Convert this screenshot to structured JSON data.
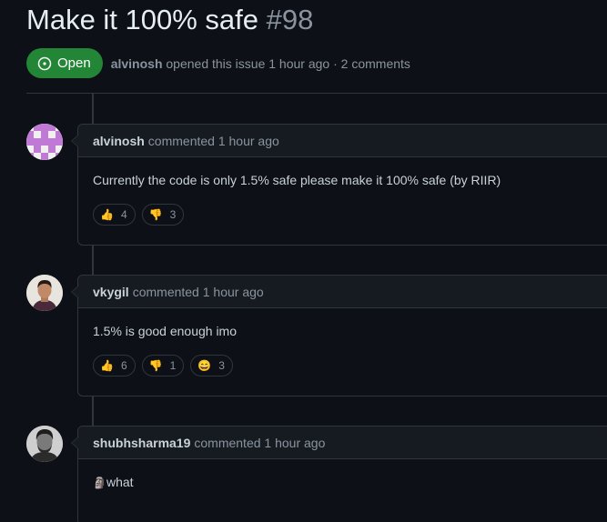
{
  "issue": {
    "title": "Make it 100% safe",
    "number": "#98",
    "state": "Open",
    "author": "alvinosh",
    "meta_action": "opened this issue",
    "meta_time": "1 hour ago",
    "meta_separator": "·",
    "meta_comments": "2 comments"
  },
  "comments": [
    {
      "author": "alvinosh",
      "action": "commented",
      "time": "1 hour ago",
      "body": "Currently the code is only 1.5% safe please make it 100% safe (by RIIR)",
      "reactions": [
        {
          "emoji": "👍",
          "count": "4",
          "icon": "thumbs-up-icon"
        },
        {
          "emoji": "👎",
          "count": "3",
          "icon": "thumbs-down-icon"
        }
      ]
    },
    {
      "author": "vkygil",
      "action": "commented",
      "time": "1 hour ago",
      "body": "1.5% is good enough imo",
      "reactions": [
        {
          "emoji": "👍",
          "count": "6",
          "icon": "thumbs-up-icon"
        },
        {
          "emoji": "👎",
          "count": "1",
          "icon": "thumbs-down-icon"
        },
        {
          "emoji": "😄",
          "count": "3",
          "icon": "laugh-icon"
        }
      ]
    },
    {
      "author": "shubhsharma19",
      "action": "commented",
      "time": "1 hour ago",
      "body_icon": "🗿",
      "body": "what"
    }
  ],
  "colors": {
    "background": "#0d1117",
    "open_badge": "#238636",
    "border": "#30363d",
    "muted": "#8b949e"
  }
}
